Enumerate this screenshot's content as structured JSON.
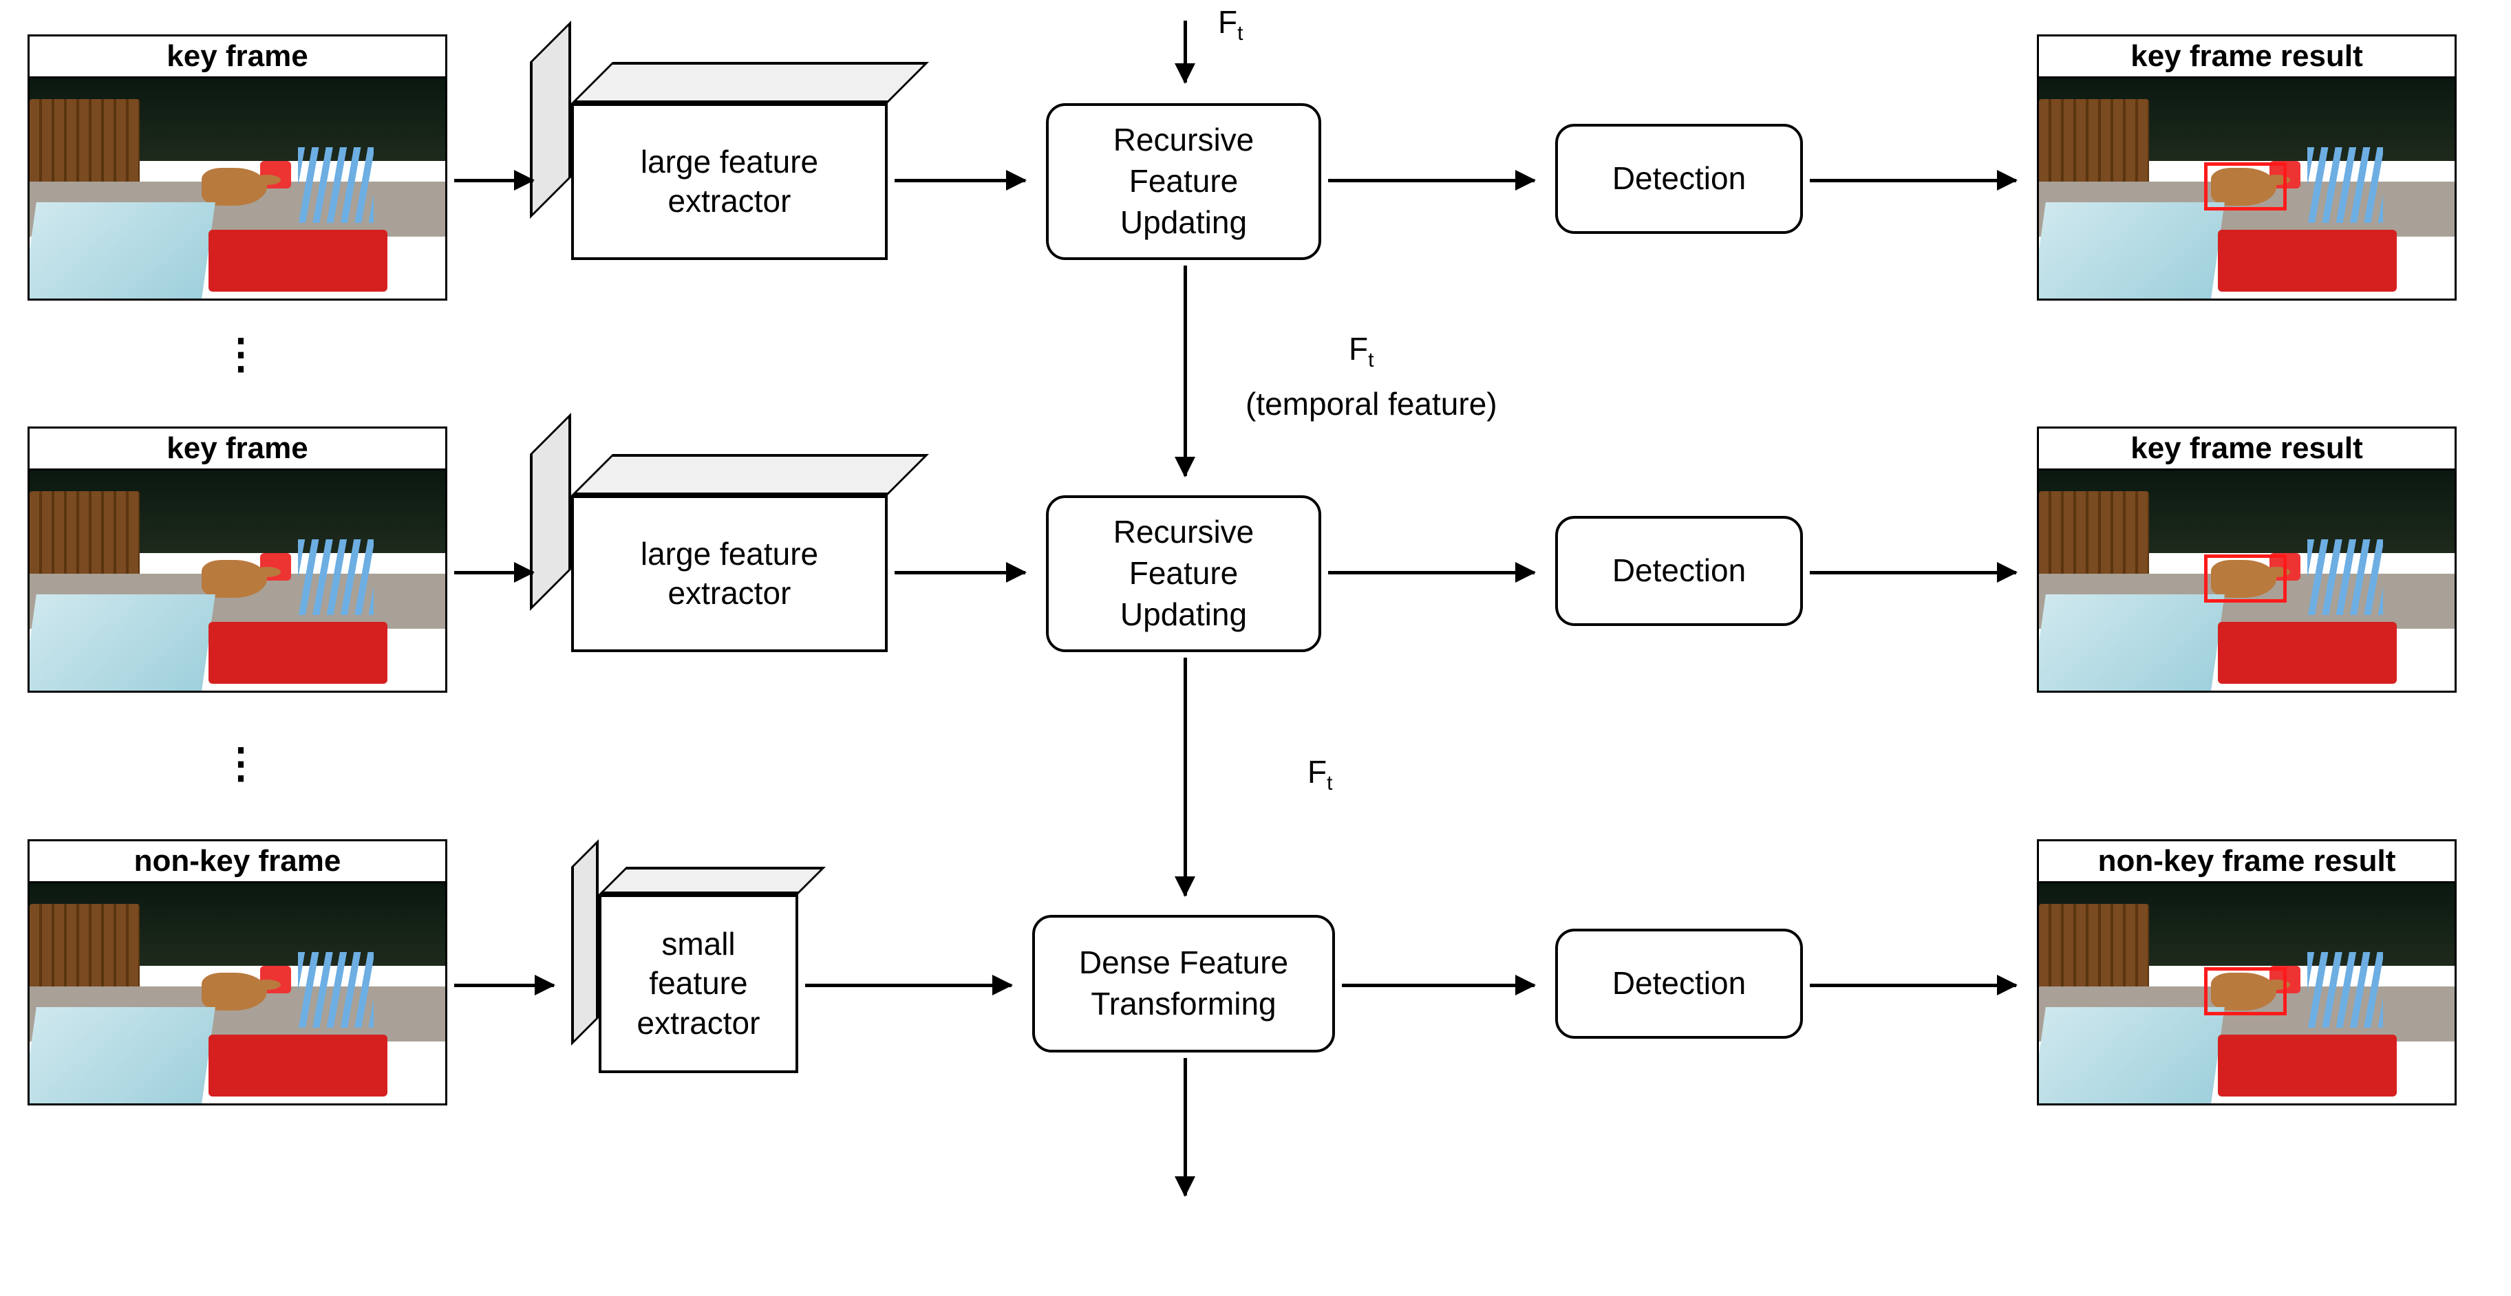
{
  "rows": [
    {
      "input_title": "key frame",
      "extractor_label": "large feature\nextractor",
      "middle_label": "Recursive\nFeature\nUpdating",
      "detect_label": "Detection",
      "output_title": "key frame result",
      "has_bbox": true
    },
    {
      "input_title": "key frame",
      "extractor_label": "large feature\nextractor",
      "middle_label": "Recursive\nFeature\nUpdating",
      "detect_label": "Detection",
      "output_title": "key frame result",
      "has_bbox": true
    },
    {
      "input_title": "non-key frame",
      "extractor_label": "small\nfeature\nextractor",
      "middle_label": "Dense Feature\nTransforming",
      "detect_label": "Detection",
      "output_title": "non-key frame result",
      "has_bbox": true
    }
  ],
  "flow_labels": {
    "top_ft": "Ft",
    "mid_ft": "Ft",
    "mid_note": "(temporal feature)",
    "bottom_ft": "Ft"
  },
  "ellipsis": "⋮"
}
